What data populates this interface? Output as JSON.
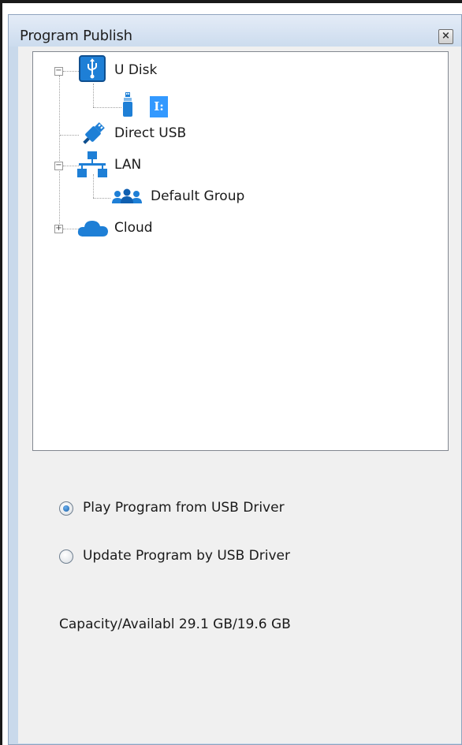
{
  "window": {
    "title": "Program Publish",
    "close_symbol": "×"
  },
  "tree": {
    "nodes": [
      {
        "label": "U Disk",
        "icon": "usb-disk-icon",
        "expander": "−"
      },
      {
        "label": "I:",
        "icon": "usb-stick-icon"
      },
      {
        "label": "Direct USB",
        "icon": "usb-cable-icon"
      },
      {
        "label": "LAN",
        "icon": "network-icon",
        "expander": "−"
      },
      {
        "label": "Default Group",
        "icon": "users-group-icon"
      },
      {
        "label": "Cloud",
        "icon": "cloud-icon",
        "expander": "+"
      }
    ]
  },
  "options": [
    {
      "label": "Play Program from USB Driver",
      "checked": true
    },
    {
      "label": "Update Program by USB Driver",
      "checked": false
    }
  ],
  "capacity_text": "Capacity/Availabl 29.1 GB/19.6 GB",
  "colors": {
    "accent": "#3399ff",
    "icon_blue": "#1e7fd6",
    "panel_bg": "#f0f0f0",
    "frame_bg": "#c9d9eb"
  }
}
